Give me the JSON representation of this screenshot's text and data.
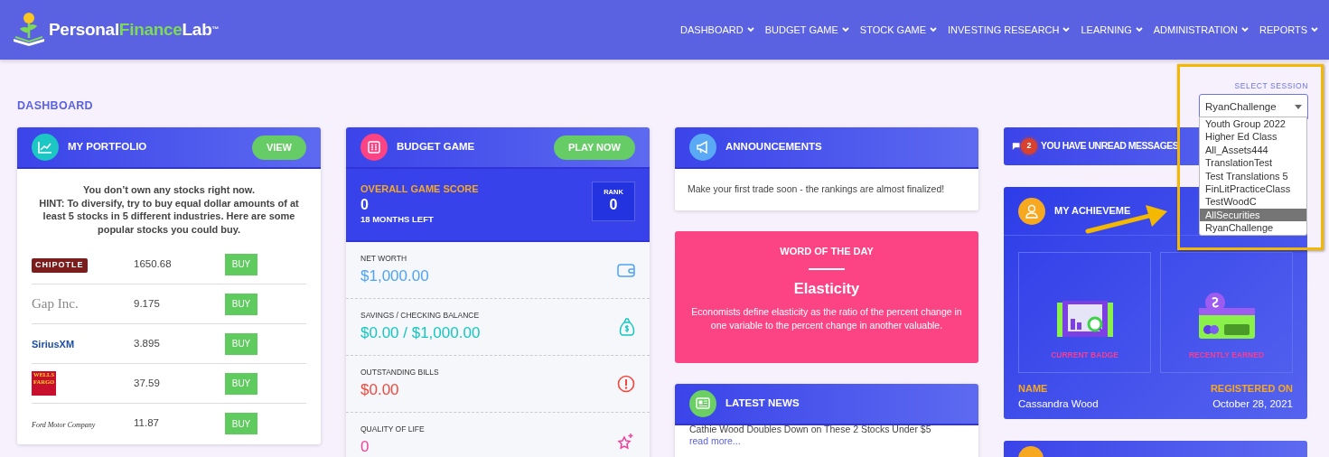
{
  "brand": {
    "parts": [
      "Personal",
      "Finance",
      "Lab"
    ],
    "mark": "™"
  },
  "nav": [
    {
      "label": "DASHBOARD"
    },
    {
      "label": "BUDGET GAME"
    },
    {
      "label": "STOCK GAME"
    },
    {
      "label": "INVESTING RESEARCH"
    },
    {
      "label": "LEARNING"
    },
    {
      "label": "ADMINISTRATION"
    },
    {
      "label": "REPORTS"
    }
  ],
  "page_title": "DASHBOARD",
  "session": {
    "label": "SELECT SESSION",
    "value": "RyanChallenge",
    "expanded": true,
    "options": [
      {
        "label": "Youth Group 2022",
        "highlighted": false
      },
      {
        "label": "Higher Ed Class",
        "highlighted": false
      },
      {
        "label": "All_Assets444",
        "highlighted": false
      },
      {
        "label": "TranslationTest",
        "highlighted": false
      },
      {
        "label": "Test Translations 5",
        "highlighted": false
      },
      {
        "label": "FinLitPracticeClass",
        "highlighted": false
      },
      {
        "label": "TestWoodC",
        "highlighted": false
      },
      {
        "label": "AllSecurities",
        "highlighted": true
      },
      {
        "label": "RyanChallenge",
        "highlighted": false
      }
    ]
  },
  "portfolio": {
    "title": "MY PORTFOLIO",
    "button": "VIEW",
    "message": "You don’t own any stocks right now.\nHINT: To diversify, try to buy equal dollar amounts of at least 5 stocks in 5 different industries. Here are some popular stocks you could buy.",
    "stocks": [
      {
        "kind": "chipotle",
        "logo": "CHIPOTLE",
        "price": "1650.68",
        "button": "BUY"
      },
      {
        "kind": "gap",
        "logo": "Gap Inc.",
        "price": "9.175",
        "button": "BUY"
      },
      {
        "kind": "sirius",
        "logo": "SiriusXM",
        "price": "3.895",
        "button": "BUY"
      },
      {
        "kind": "wells",
        "logo": "WELLS FARGO",
        "price": "37.59",
        "button": "BUY"
      },
      {
        "kind": "ford",
        "logo": "Ford Motor Company",
        "price": "11.87",
        "button": "BUY"
      }
    ]
  },
  "budget": {
    "title": "BUDGET GAME",
    "button": "PLAY NOW",
    "score_label": "OVERALL GAME SCORE",
    "score": "0",
    "months_left": "18 MONTHS LEFT",
    "rank_label": "RANK",
    "rank": "0",
    "metrics": [
      {
        "kind": "wallet",
        "label": "NET WORTH",
        "value": "$1,000.00",
        "color": "#4fa3f7"
      },
      {
        "kind": "money-bag",
        "label": "SAVINGS / CHECKING BALANCE",
        "value": "$0.00 / $1,000.00",
        "color": "#16c7c0"
      },
      {
        "kind": "alert",
        "label": "OUTSTANDING BILLS",
        "value": "$0.00",
        "color": "#f0483e"
      },
      {
        "kind": "sparkle",
        "label": "QUALITY OF LIFE",
        "value": "0",
        "color": "#f0419a"
      }
    ]
  },
  "announcements": {
    "title": "ANNOUNCEMENTS",
    "text": "Make your first trade soon - the rankings are almost finalized!"
  },
  "word": {
    "heading": "WORD OF THE DAY",
    "word": "Elasticity",
    "definition": "Economists define elasticity as the ratio of the percent change in one variable to the percent change in another valuable."
  },
  "news": {
    "title": "LATEST NEWS",
    "items": [
      {
        "text": "Cathie Wood Doubles Down on These 2 Stocks Under $5",
        "link": "read more..."
      }
    ]
  },
  "messages": {
    "count": "2",
    "title": "YOU HAVE UNREAD MESSAGES"
  },
  "achievements": {
    "title": "MY ACHIEVEME",
    "tiles": [
      {
        "kind": "badge",
        "caption": "CURRENT BADGE"
      },
      {
        "kind": "level",
        "caption": "RECENTLY EARNED"
      }
    ],
    "name_label": "NAME",
    "name": "Cassandra Wood",
    "registered_label": "REGISTERED ON",
    "registered": "October 28, 2021"
  }
}
